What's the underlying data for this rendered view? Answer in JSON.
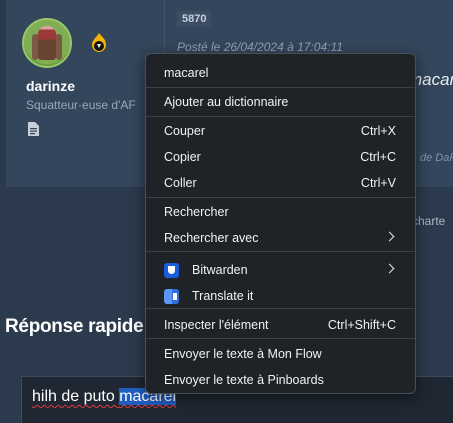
{
  "post": {
    "username": "darinze",
    "rank": "Squatteur·euse d'AF",
    "number": "5870",
    "date": "Posté le 26/04/2024 à 17:04:11",
    "content_fragment": "macarè",
    "edit_note_fragment": "de DaR",
    "link_fragment": "charte"
  },
  "quick_reply": {
    "title": "Réponse rapide",
    "text_before": "hilh de puto ",
    "word_selected": "macarel"
  },
  "context_menu": {
    "items": [
      {
        "label": "macarel"
      },
      {
        "label": "Ajouter au dictionnaire"
      },
      {
        "label": "Couper",
        "shortcut": "Ctrl+X"
      },
      {
        "label": "Copier",
        "shortcut": "Ctrl+C"
      },
      {
        "label": "Coller",
        "shortcut": "Ctrl+V"
      },
      {
        "label": "Rechercher"
      },
      {
        "label": "Rechercher avec",
        "submenu": true
      },
      {
        "label": "Bitwarden",
        "icon": "bitwarden-icon",
        "submenu": true
      },
      {
        "label": "Translate it",
        "icon": "translate-icon"
      },
      {
        "label": "Inspecter l'élément",
        "shortcut": "Ctrl+Shift+C"
      },
      {
        "label": "Envoyer le texte à Mon Flow"
      },
      {
        "label": "Envoyer le texte à Pinboards"
      }
    ]
  },
  "colors": {
    "page_bg": "#2b3a4d",
    "post_bg": "#34465b",
    "menu_bg": "#1f2227",
    "selection": "#1f5fc4",
    "spellcheck": "#e03a3a"
  }
}
